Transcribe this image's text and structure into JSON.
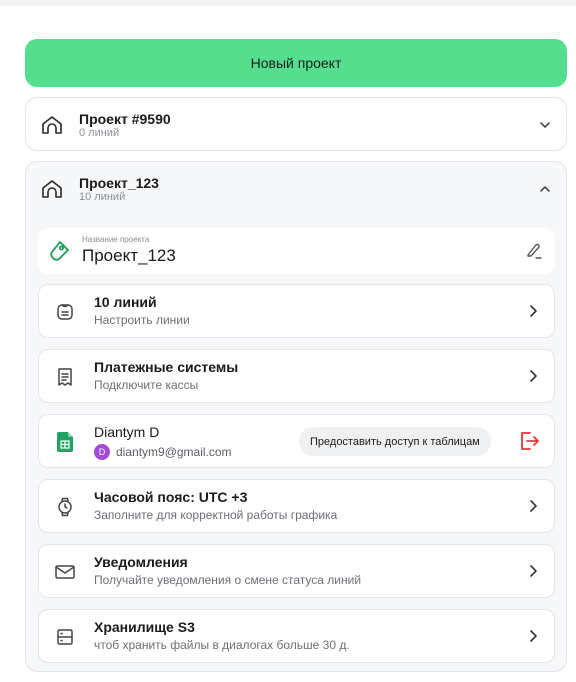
{
  "new_project_button": "Новый проект",
  "projects": [
    {
      "title": "Проект #9590",
      "subtitle": "0 линий"
    },
    {
      "title": "Проект_123",
      "subtitle": "10 линий"
    }
  ],
  "project_name": {
    "label": "Название проекта",
    "value": "Проект_123"
  },
  "settings": {
    "lines": {
      "title": "10 линий",
      "subtitle": "Настроить линии"
    },
    "payments": {
      "title": "Платежные системы",
      "subtitle": "Подключите кассы"
    },
    "google": {
      "name": "Diantym D",
      "avatar_letter": "D",
      "email": "diantym9@gmail.com",
      "share_label": "Предоставить доступ к таблицам"
    },
    "timezone": {
      "title": "Часовой пояс: UTC +3",
      "subtitle": "Заполните для корректной работы графика"
    },
    "notifications": {
      "title": "Уведомления",
      "subtitle": "Получайте уведомления о смене статуса линий"
    },
    "storage": {
      "title": "Хранилище S3",
      "subtitle": "чтоб хранить файлы в диалогах больше 30 д."
    }
  },
  "colors": {
    "accent": "#56de8f",
    "danger": "#e8343a",
    "sheets": "#1fa463",
    "avatar": "#a14ad6"
  }
}
